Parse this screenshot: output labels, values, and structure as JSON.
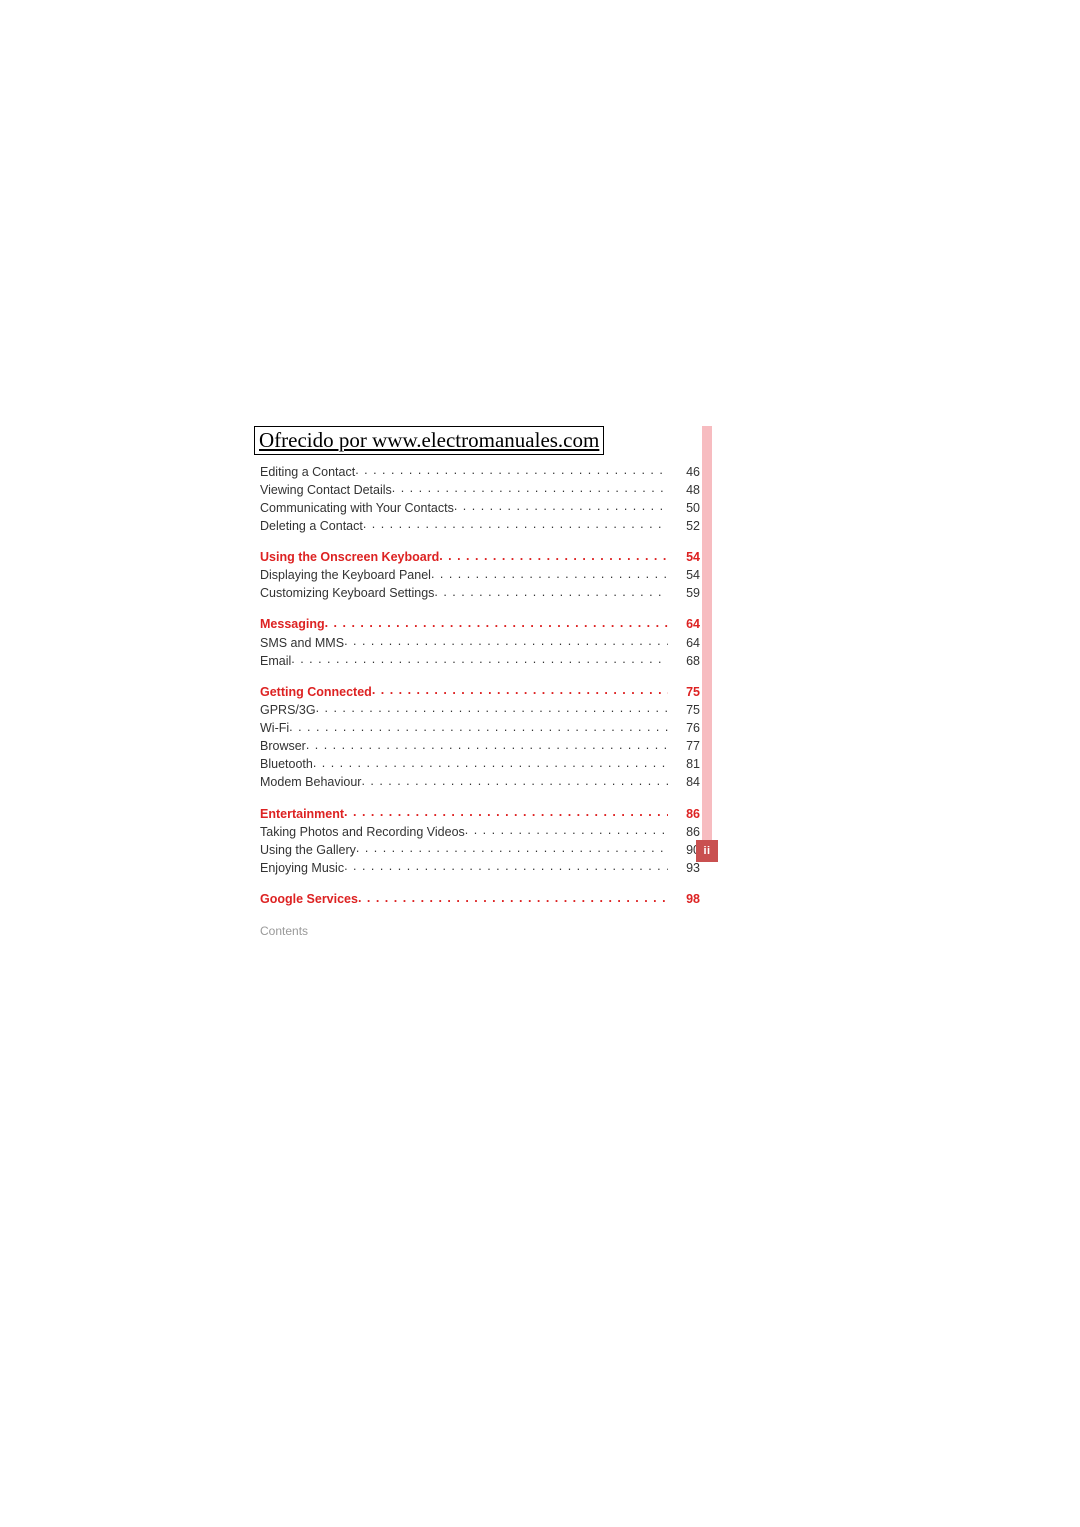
{
  "header": "Ofrecido por www.electromanuales.com",
  "footer": "Contents",
  "page_indicator": "ii",
  "toc": [
    {
      "type": "item",
      "label": "Editing a Contact",
      "page": "46"
    },
    {
      "type": "item",
      "label": "Viewing Contact Details",
      "page": "48"
    },
    {
      "type": "item",
      "label": "Communicating with Your Contacts",
      "page": "50"
    },
    {
      "type": "item",
      "label": "Deleting a Contact",
      "page": "52"
    },
    {
      "type": "chapter",
      "label": "Using the Onscreen Keyboard",
      "page": "54"
    },
    {
      "type": "item",
      "label": "Displaying the Keyboard Panel",
      "page": "54"
    },
    {
      "type": "item",
      "label": "Customizing Keyboard Settings",
      "page": "59"
    },
    {
      "type": "chapter",
      "label": "Messaging",
      "page": "64"
    },
    {
      "type": "item",
      "label": "SMS and MMS",
      "page": "64"
    },
    {
      "type": "item",
      "label": "Email",
      "page": "68"
    },
    {
      "type": "chapter",
      "label": "Getting Connected",
      "page": "75"
    },
    {
      "type": "item",
      "label": "GPRS/3G",
      "page": "75"
    },
    {
      "type": "item",
      "label": "Wi-Fi",
      "page": "76"
    },
    {
      "type": "item",
      "label": "Browser",
      "page": "77"
    },
    {
      "type": "item",
      "label": "Bluetooth",
      "page": "81"
    },
    {
      "type": "item",
      "label": "Modem Behaviour",
      "page": "84"
    },
    {
      "type": "chapter",
      "label": "Entertainment",
      "page": "86"
    },
    {
      "type": "item",
      "label": "Taking Photos and Recording Videos",
      "page": "86"
    },
    {
      "type": "item",
      "label": "Using the Gallery",
      "page": "90"
    },
    {
      "type": "item",
      "label": "Enjoying Music",
      "page": "93"
    },
    {
      "type": "chapter",
      "label": "Google Services",
      "page": "98"
    }
  ]
}
